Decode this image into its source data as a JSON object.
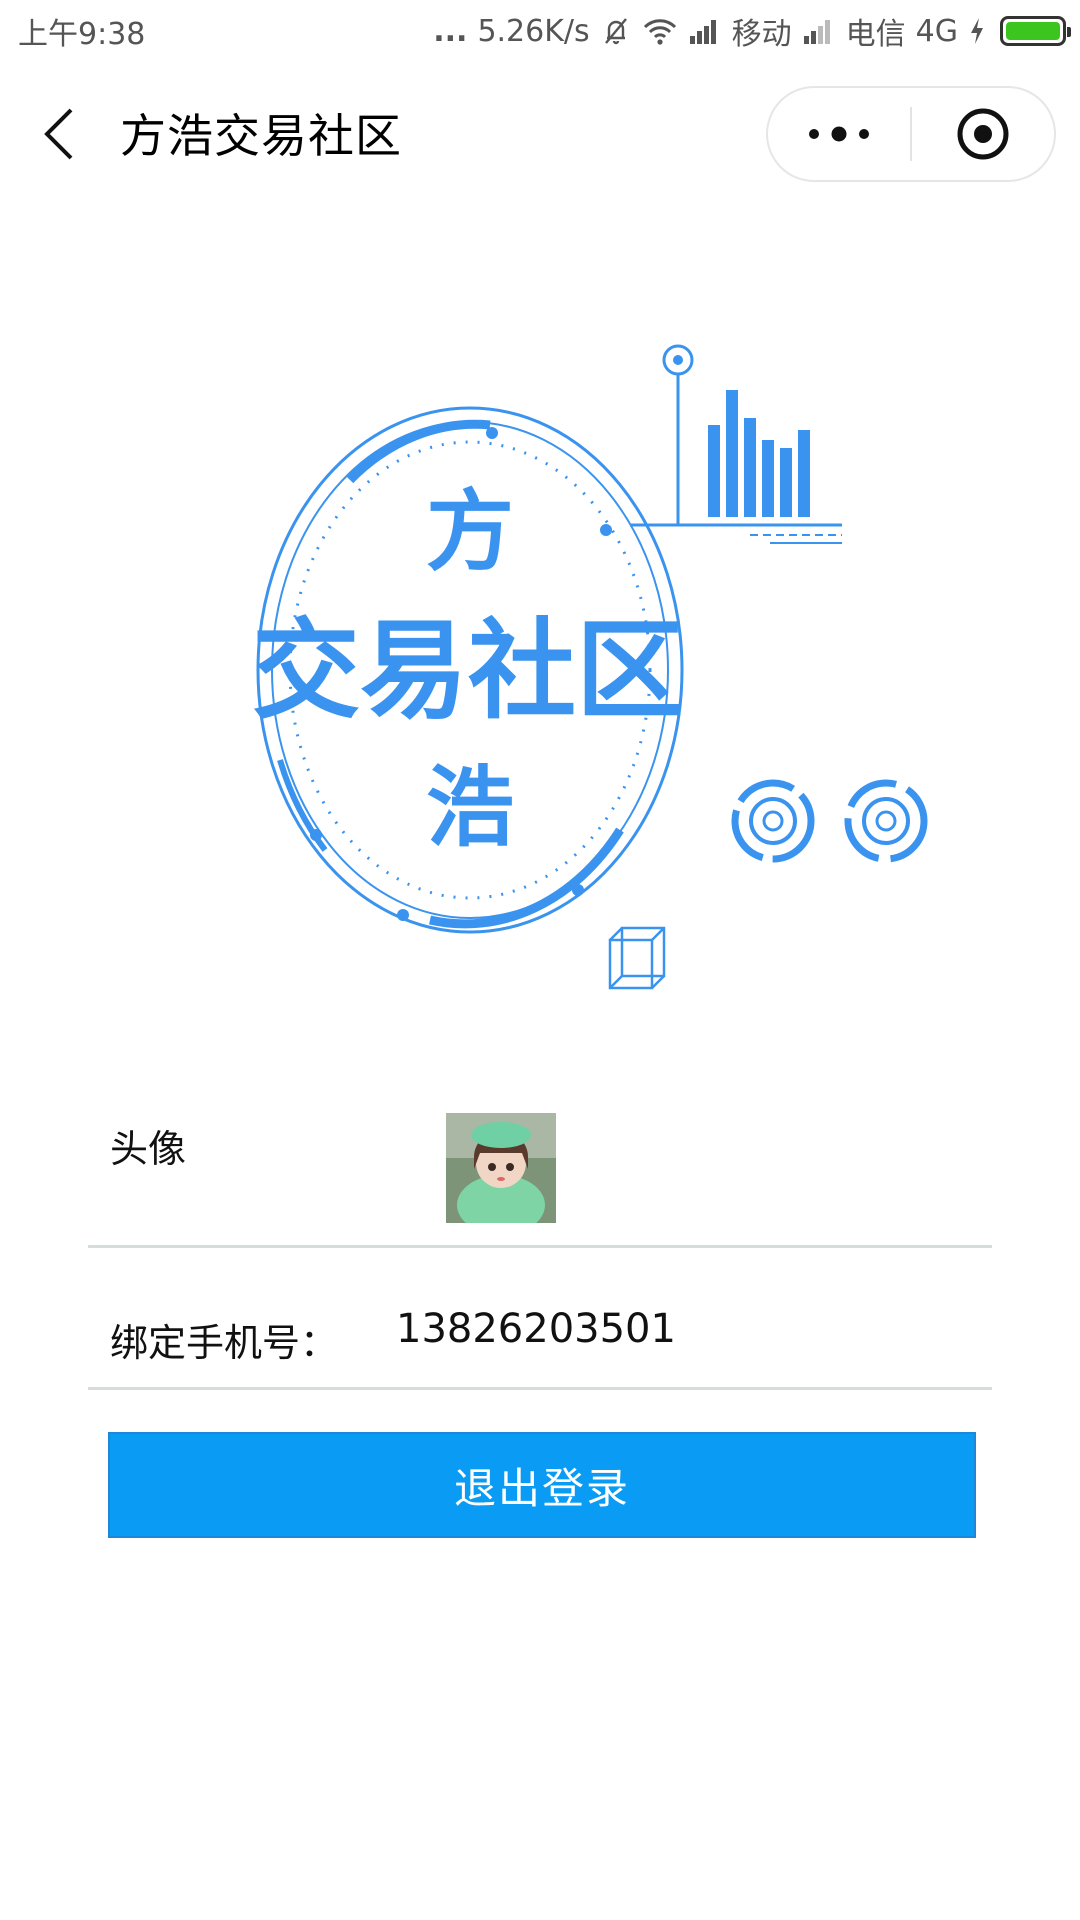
{
  "status_bar": {
    "time": "上午9:38",
    "dots": "...",
    "network_speed": "5.26K/s",
    "carrier_1": "移动",
    "carrier_2": "电信",
    "network_type": "4G",
    "icons": [
      "bell-muted-icon",
      "wifi-icon",
      "signal-icon",
      "charging-icon",
      "battery-icon"
    ],
    "battery_color": "#3cc51f"
  },
  "nav": {
    "title": "方浩交易社区",
    "icons": [
      "back-chevron-icon",
      "more-dots-icon",
      "close-target-icon"
    ]
  },
  "logo": {
    "char_top": "方",
    "main_text": "交易社区",
    "char_bottom": "浩",
    "color": "#2f8ff0"
  },
  "profile": {
    "avatar_label": "头像",
    "phone_label": "绑定手机号：",
    "phone_value": "13826203501"
  },
  "actions": {
    "logout_label": "退出登录",
    "logout_color": "#0a9bf5"
  }
}
